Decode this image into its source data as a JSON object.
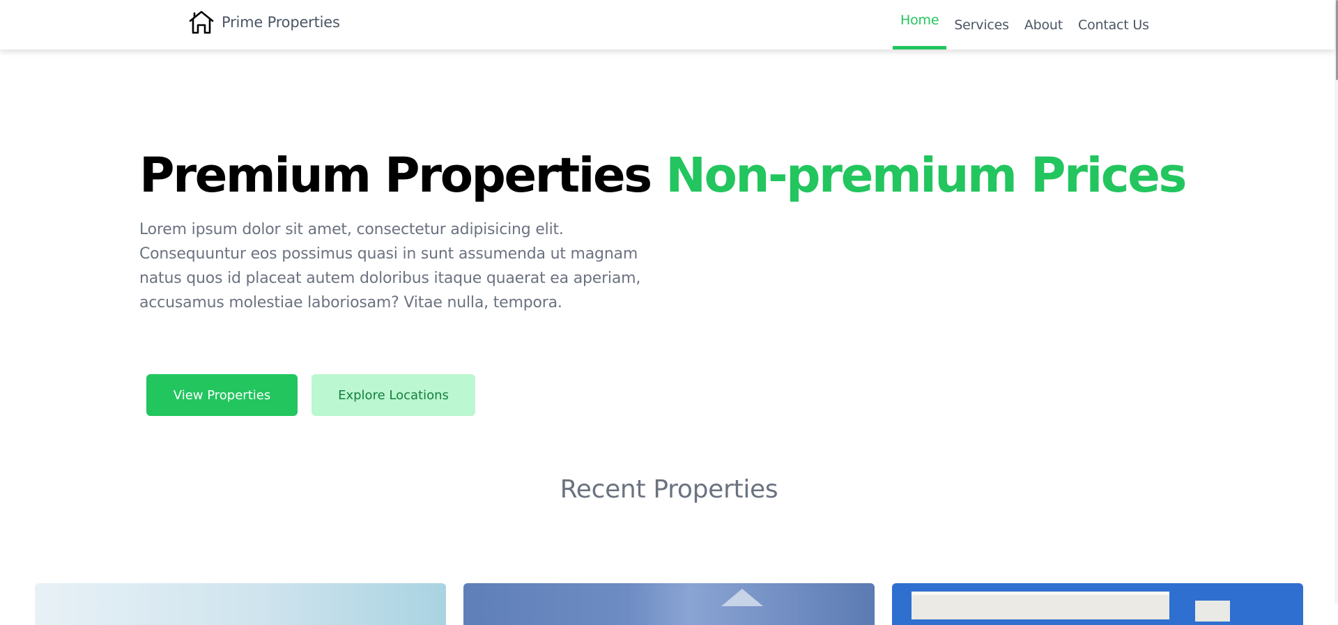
{
  "navbar": {
    "brand_name": "Prime Properties",
    "brand_icon": "house-outline-icon",
    "links": [
      {
        "label": "Home",
        "active": true
      },
      {
        "label": "Services",
        "active": false
      },
      {
        "label": "About",
        "active": false
      },
      {
        "label": "Contact Us",
        "active": false
      }
    ]
  },
  "hero": {
    "title_main": "Premium Properties",
    "title_accent": "Non-premium Prices",
    "description": "Lorem ipsum dolor sit amet, consectetur adipisicing elit. Consequuntur eos possimus quasi in sunt assumenda ut magnam natus quos id placeat autem doloribus itaque quaerat ea aperiam, accusamus molestiae laboriosam? Vitae nulla, tempora.",
    "primary_button": "View Properties",
    "secondary_button": "Explore Locations"
  },
  "recent": {
    "title": "Recent Properties"
  },
  "colors": {
    "accent": "#22c55e",
    "accent_light": "#bbf7d0",
    "accent_dark": "#15803d",
    "text_muted": "#6b7280",
    "nav_text": "#4b5563"
  }
}
